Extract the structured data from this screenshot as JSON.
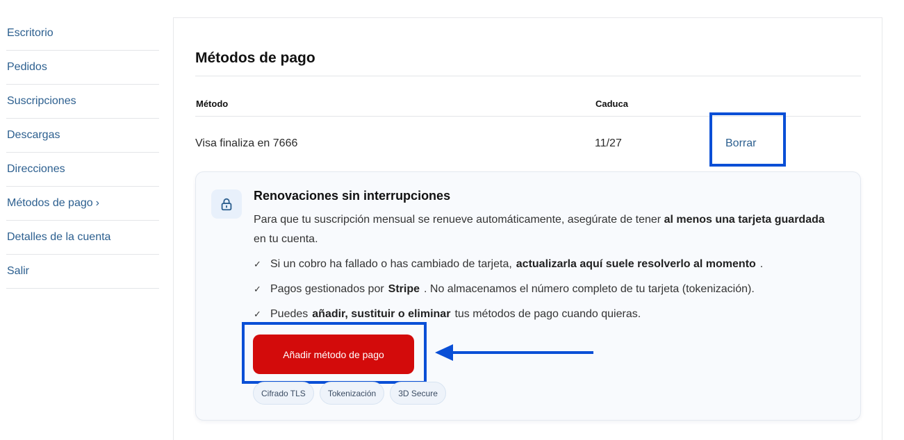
{
  "sidebar": {
    "items": [
      {
        "label": "Escritorio"
      },
      {
        "label": "Pedidos"
      },
      {
        "label": "Suscripciones"
      },
      {
        "label": "Descargas"
      },
      {
        "label": "Direcciones"
      },
      {
        "label": "Métodos de pago",
        "chevron": "›"
      },
      {
        "label": "Detalles de la cuenta"
      },
      {
        "label": "Salir"
      }
    ]
  },
  "main": {
    "title": "Métodos de pago",
    "table": {
      "headers": {
        "method": "Método",
        "expires": "Caduca"
      },
      "rows": [
        {
          "method": "Visa finaliza en 7666",
          "expires": "11/27",
          "action": "Borrar"
        }
      ]
    },
    "card": {
      "icon": "lock-icon",
      "title": "Renovaciones sin interrupciones",
      "desc_pre": "Para que tu suscripción mensual se renueve automáticamente, asegúrate de tener ",
      "desc_bold": "al menos una tarjeta guardada",
      "desc_post": " en tu cuenta.",
      "checks": [
        {
          "pre": "Si un cobro ha fallado o has cambiado de tarjeta,",
          "bold": "actualizarla aquí suele resolverlo al momento",
          "post": "."
        },
        {
          "pre": "Pagos gestionados por",
          "bold": "Stripe",
          "post": ". No almacenamos el número completo de tu tarjeta (tokenización)."
        },
        {
          "pre": "Puedes",
          "bold": "añadir, sustituir o eliminar",
          "post": "tus métodos de pago cuando quieras."
        }
      ],
      "add_button": "Añadir método de pago",
      "badges": [
        "Cifrado TLS",
        "Tokenización",
        "3D Secure"
      ]
    }
  },
  "colors": {
    "accent_red": "#d30b0b",
    "link_blue": "#2c5f8f",
    "highlight_blue": "#0a4fd6"
  }
}
